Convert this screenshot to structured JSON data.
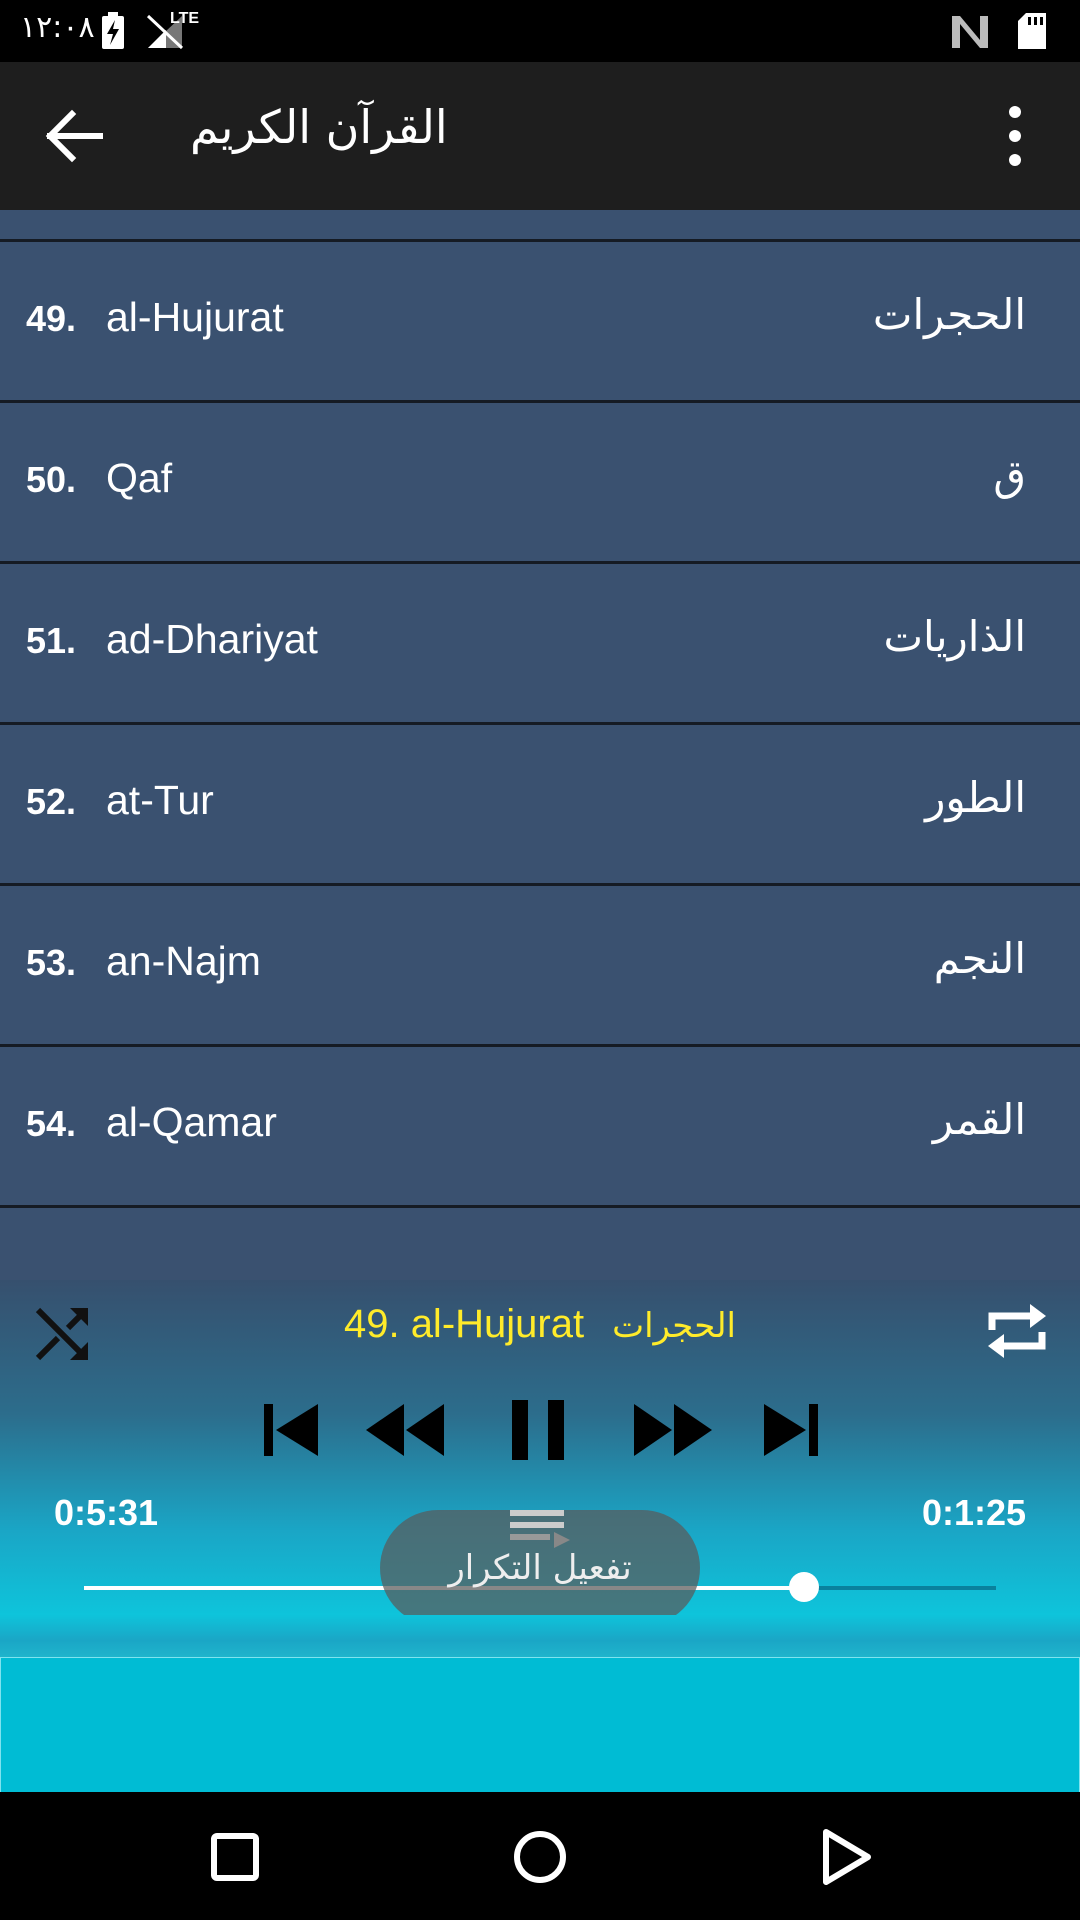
{
  "status_bar": {
    "time": "١٢:٠٨",
    "icons": [
      "battery-charging-icon",
      "signal-lte-icon",
      "nfc-icon",
      "sd-card-icon"
    ],
    "lte_label": "LTE"
  },
  "app_bar": {
    "title": "القرآن الكريم",
    "back_icon": "arrow-back-icon",
    "menu_icon": "more-vert-icon"
  },
  "surah_list": [
    {
      "number": "49.",
      "name_en": "al-Hujurat",
      "name_ar": "الحجرات"
    },
    {
      "number": "50.",
      "name_en": "Qaf",
      "name_ar": "ق"
    },
    {
      "number": "51.",
      "name_en": "ad-Dhariyat",
      "name_ar": "الذاريات"
    },
    {
      "number": "52.",
      "name_en": "at-Tur",
      "name_ar": "الطور"
    },
    {
      "number": "53.",
      "name_en": "an-Najm",
      "name_ar": "النجم"
    },
    {
      "number": "54.",
      "name_en": "al-Qamar",
      "name_ar": "القمر"
    }
  ],
  "player": {
    "now_playing_en": "49. al-Hujurat",
    "now_playing_ar": "الحجرات",
    "time_elapsed": "0:5:31",
    "time_remaining": "0:1:25",
    "progress_fraction": 0.79,
    "toast_text": "تفعيل التكرار",
    "colors": {
      "accent_text": "#ffeb2a",
      "list_bg": "#3a5170",
      "ad_bg": "#00bcd4"
    }
  }
}
